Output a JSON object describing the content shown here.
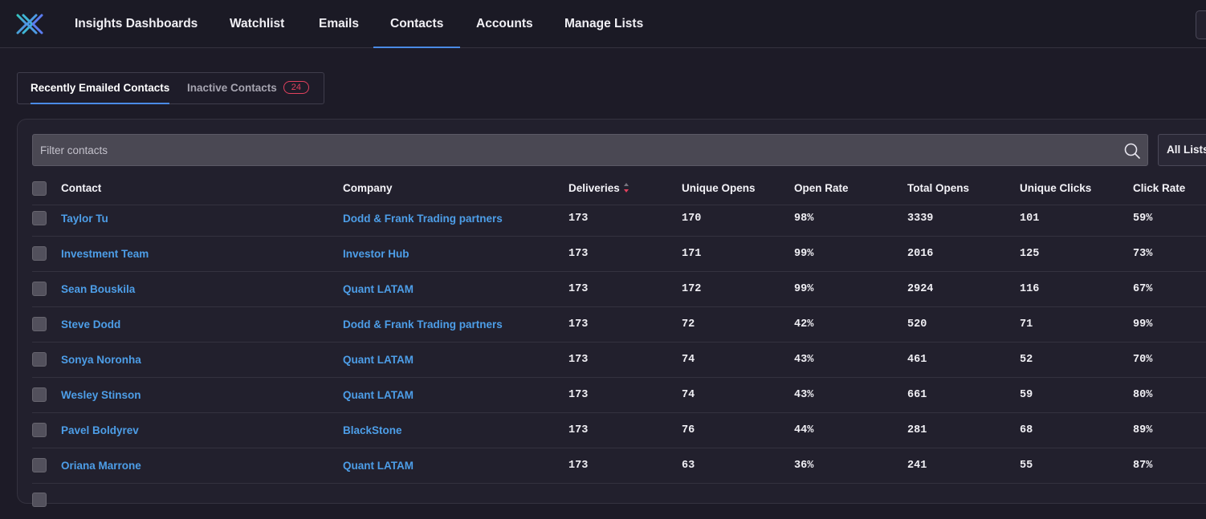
{
  "nav": {
    "items": [
      {
        "label": "Insights Dashboards"
      },
      {
        "label": "Watchlist"
      },
      {
        "label": "Emails"
      },
      {
        "label": "Contacts"
      },
      {
        "label": "Accounts"
      },
      {
        "label": "Manage Lists"
      }
    ],
    "active": "Contacts"
  },
  "tabs": {
    "recent": "Recently Emailed Contacts",
    "inactive": "Inactive Contacts",
    "inactive_count": "24"
  },
  "filter": {
    "placeholder": "Filter contacts",
    "list_select": "All Lists"
  },
  "table": {
    "columns": [
      "Contact",
      "Company",
      "Deliveries",
      "Unique Opens",
      "Open Rate",
      "Total Opens",
      "Unique Clicks",
      "Click Rate"
    ],
    "sorted_column": "Deliveries",
    "rows": [
      {
        "contact": "Taylor Tu",
        "company": "Dodd & Frank Trading partners",
        "deliveries": "173",
        "unique_opens": "170",
        "open_rate": "98%",
        "total_opens": "3339",
        "unique_clicks": "101",
        "click_rate": "59%"
      },
      {
        "contact": "Investment Team",
        "company": "Investor Hub",
        "deliveries": "173",
        "unique_opens": "171",
        "open_rate": "99%",
        "total_opens": "2016",
        "unique_clicks": "125",
        "click_rate": "73%"
      },
      {
        "contact": "Sean Bouskila",
        "company": "Quant LATAM",
        "deliveries": "173",
        "unique_opens": "172",
        "open_rate": "99%",
        "total_opens": "2924",
        "unique_clicks": "116",
        "click_rate": "67%"
      },
      {
        "contact": "Steve Dodd",
        "company": "Dodd & Frank Trading partners",
        "deliveries": "173",
        "unique_opens": "72",
        "open_rate": "42%",
        "total_opens": "520",
        "unique_clicks": "71",
        "click_rate": "99%"
      },
      {
        "contact": "Sonya Noronha",
        "company": "Quant LATAM",
        "deliveries": "173",
        "unique_opens": "74",
        "open_rate": "43%",
        "total_opens": "461",
        "unique_clicks": "52",
        "click_rate": "70%"
      },
      {
        "contact": "Wesley Stinson",
        "company": "Quant LATAM",
        "deliveries": "173",
        "unique_opens": "74",
        "open_rate": "43%",
        "total_opens": "661",
        "unique_clicks": "59",
        "click_rate": "80%"
      },
      {
        "contact": "Pavel Boldyrev",
        "company": "BlackStone",
        "deliveries": "173",
        "unique_opens": "76",
        "open_rate": "44%",
        "total_opens": "281",
        "unique_clicks": "68",
        "click_rate": "89%"
      },
      {
        "contact": "Oriana Marrone",
        "company": "Quant LATAM",
        "deliveries": "173",
        "unique_opens": "63",
        "open_rate": "36%",
        "total_opens": "241",
        "unique_clicks": "55",
        "click_rate": "87%"
      }
    ]
  },
  "colors": {
    "accent": "#4a8be6",
    "link": "#4d9ee8",
    "badge": "#e2415d"
  }
}
